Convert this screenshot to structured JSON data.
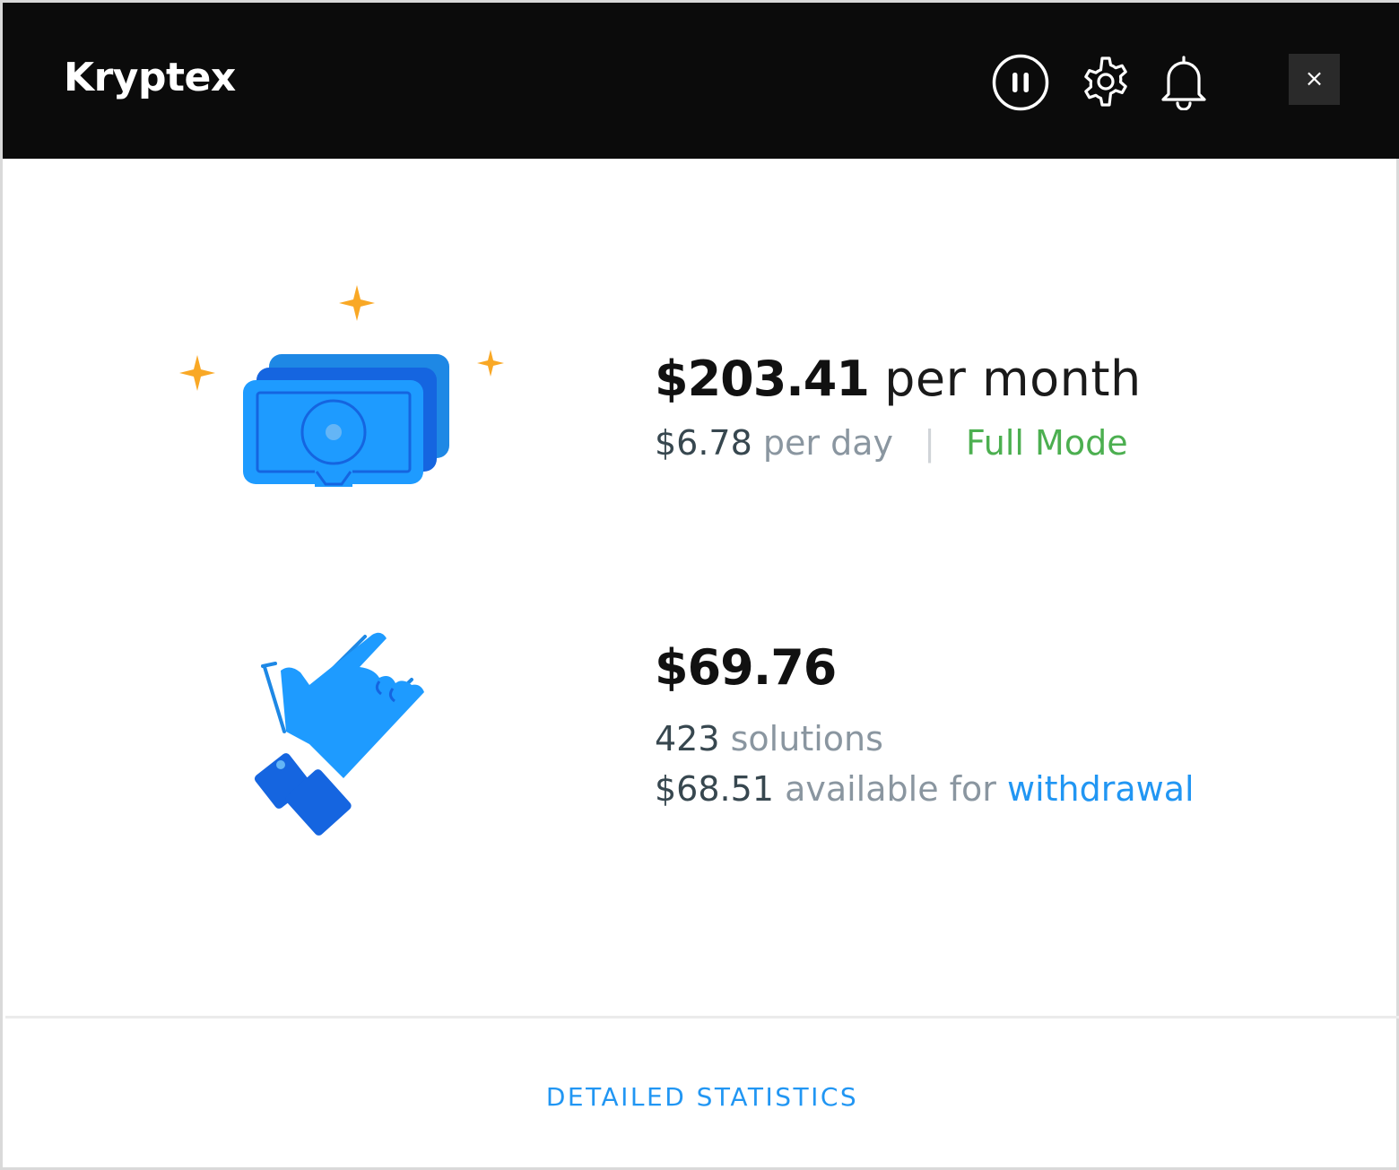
{
  "app": {
    "title": "Kryptex"
  },
  "toolbar": {
    "pause_icon": "pause-circle-icon",
    "settings_icon": "gear-icon",
    "notifications_icon": "bell-icon",
    "close_label": "×"
  },
  "earnings": {
    "monthly_amount": "$203.41",
    "monthly_suffix": "per month",
    "daily_amount": "$6.78",
    "daily_suffix": "per day",
    "separator": "|",
    "mode": "Full Mode",
    "illustration_icon": "money-stack-icon"
  },
  "balance": {
    "amount": "$69.76",
    "solutions_count": "423",
    "solutions_label": "solutions",
    "available_amount": "$68.51",
    "available_label": "available for",
    "withdrawal_link": "withdrawal",
    "illustration_icon": "hand-grab-icon"
  },
  "footer": {
    "detailed_stats_label": "DETAILED STATISTICS"
  },
  "colors": {
    "titlebar": "#0b0b0b",
    "accent_blue": "#2196f3",
    "mode_green": "#4caf50",
    "sparkle": "#f9a825"
  }
}
